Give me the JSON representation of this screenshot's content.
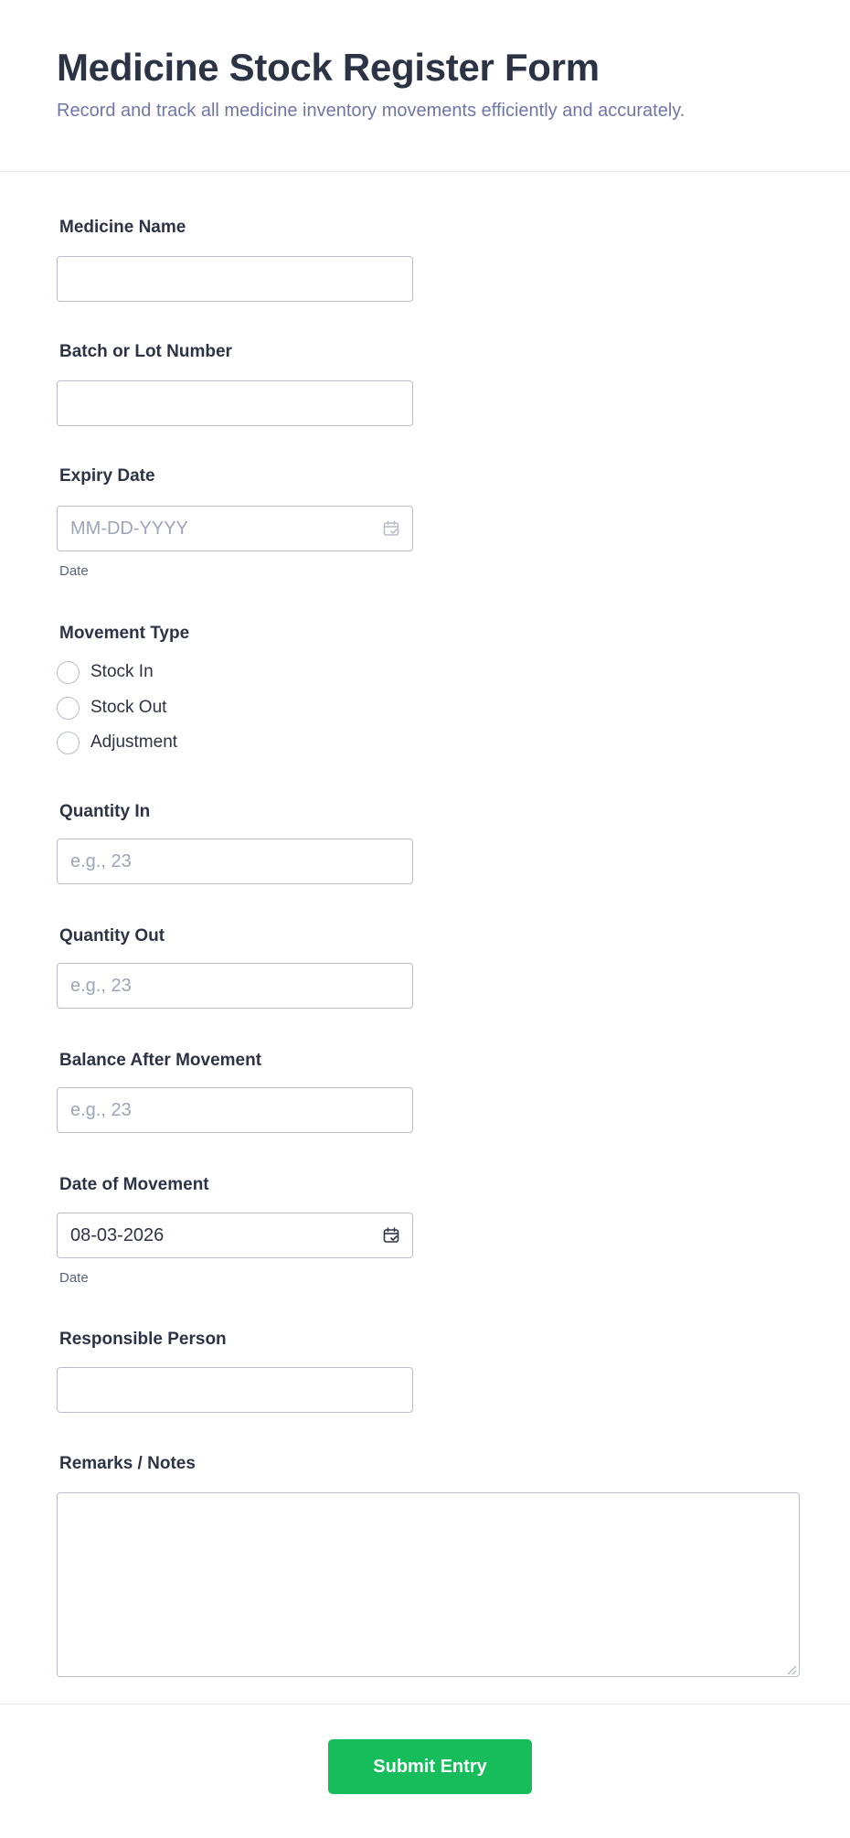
{
  "header": {
    "title": "Medicine Stock Register Form",
    "subtitle": "Record and track all medicine inventory movements efficiently and accurately."
  },
  "fields": {
    "medicine_name": {
      "label": "Medicine Name",
      "value": ""
    },
    "batch_number": {
      "label": "Batch or Lot Number",
      "value": ""
    },
    "expiry_date": {
      "label": "Expiry Date",
      "placeholder": "MM-DD-YYYY",
      "value": "",
      "sublabel": "Date",
      "icon": "calendar-icon"
    },
    "movement_type": {
      "label": "Movement Type",
      "options": [
        "Stock In",
        "Stock Out",
        "Adjustment"
      ],
      "selected": null
    },
    "quantity_in": {
      "label": "Quantity In",
      "placeholder": "e.g., 23",
      "value": ""
    },
    "quantity_out": {
      "label": "Quantity Out",
      "placeholder": "e.g., 23",
      "value": ""
    },
    "balance_after": {
      "label": "Balance After Movement",
      "placeholder": "e.g., 23",
      "value": ""
    },
    "movement_date": {
      "label": "Date of Movement",
      "value": "08-03-2026",
      "sublabel": "Date",
      "icon": "calendar-icon"
    },
    "responsible_person": {
      "label": "Responsible Person",
      "value": ""
    },
    "remarks": {
      "label": "Remarks / Notes",
      "value": ""
    }
  },
  "submit": {
    "label": "Submit Entry"
  },
  "colors": {
    "accent": "#18bd5b",
    "text": "#2c3345",
    "muted": "#6f76a7",
    "border": "#b8bdc9"
  }
}
